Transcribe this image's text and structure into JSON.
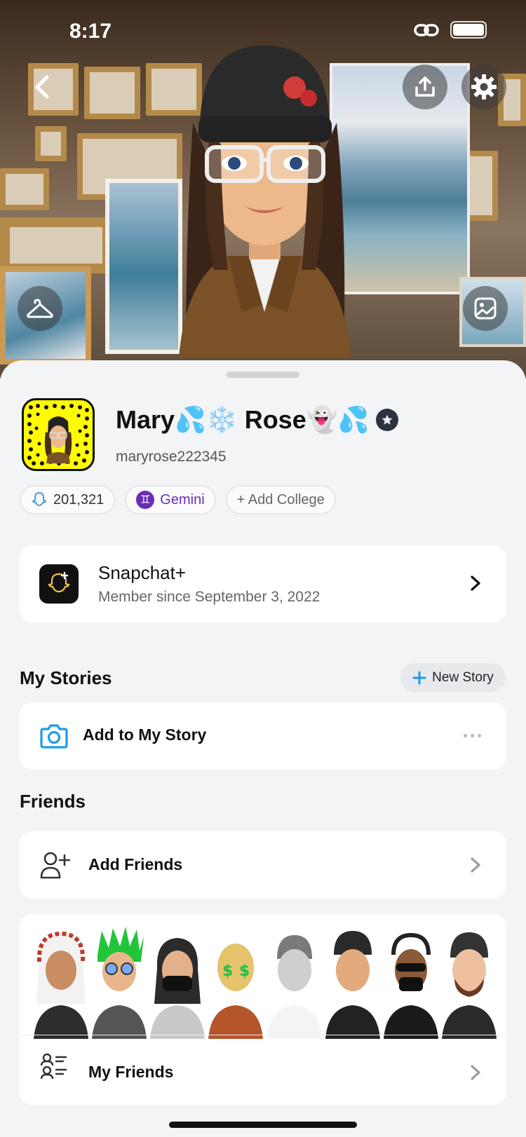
{
  "status_bar": {
    "time": "8:17"
  },
  "profile": {
    "display_name": "Mary💦❄️ Rose👻💦",
    "username": "maryrose222345"
  },
  "chips": {
    "score": "201,321",
    "zodiac": "Gemini",
    "zodiac_symbol": "♊",
    "add_college": "+ Add College"
  },
  "snapchat_plus": {
    "title": "Snapchat+",
    "subtitle": "Member since September 3, 2022"
  },
  "stories": {
    "section_title": "My Stories",
    "new_story_label": "New Story",
    "add_to_story_label": "Add to My Story"
  },
  "friends": {
    "section_title": "Friends",
    "add_friends_label": "Add Friends",
    "my_friends_label": "My Friends",
    "avatar_count": 8
  },
  "colors": {
    "snapchat_yellow": "#fffc00",
    "accent_blue": "#1a9bf0",
    "gemini_purple": "#6a2db8",
    "sheet_bg": "#f3f4f6"
  },
  "icons": {
    "back": "chevron-left-icon",
    "share": "share-icon",
    "settings": "gear-icon",
    "wardrobe": "hanger-icon",
    "selfie": "picture-icon",
    "camera": "camera-icon",
    "add_friend": "add-person-icon",
    "friends_list": "friends-list-icon"
  }
}
